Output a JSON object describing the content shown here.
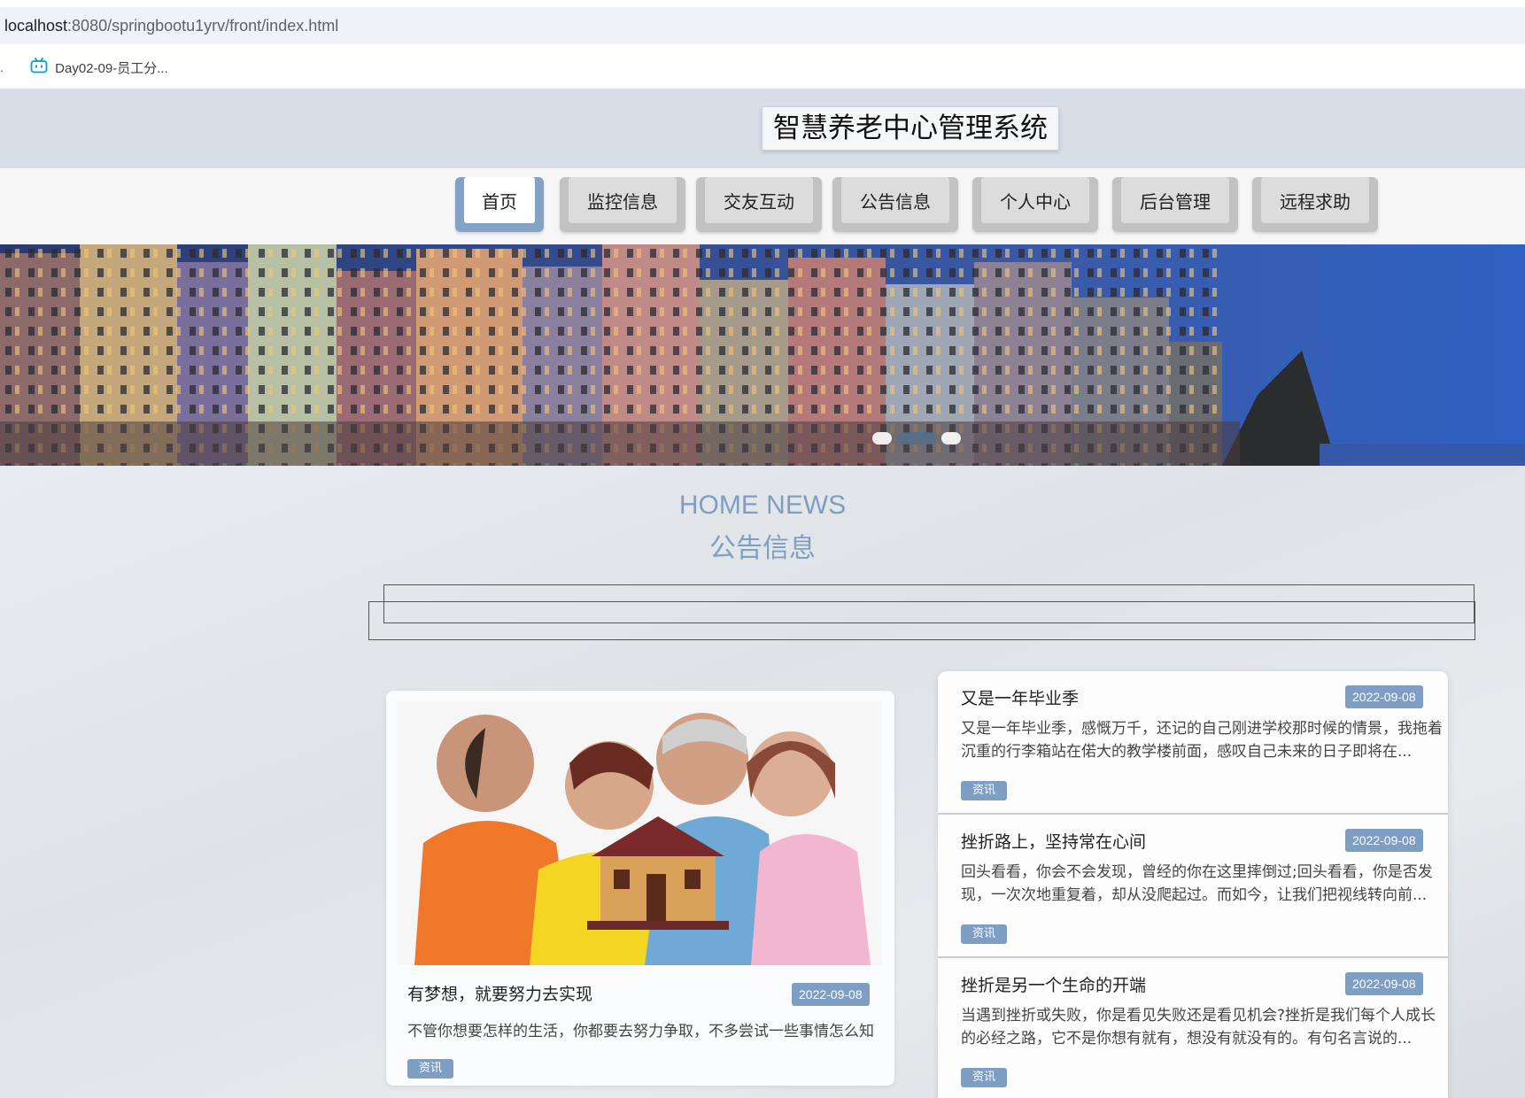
{
  "browser": {
    "url_host": "localhost",
    "url_rest": ":8080/springbootu1yrv/front/index.html",
    "bookmark_dot": ".",
    "bookmark_label": "Day02-09-员工分..."
  },
  "header": {
    "title": "智慧养老中心管理系统"
  },
  "nav": {
    "items": [
      {
        "label": "首页",
        "active": true
      },
      {
        "label": "监控信息"
      },
      {
        "label": "交友互动"
      },
      {
        "label": "公告信息"
      },
      {
        "label": "个人中心"
      },
      {
        "label": "后台管理"
      },
      {
        "label": "远程求助"
      }
    ]
  },
  "banner": {
    "slide_count": 3,
    "active_slide": 2
  },
  "section": {
    "title_en": "HOME NEWS",
    "title_zh": "公告信息"
  },
  "feature": {
    "title": "有梦想，就要努力去实现",
    "date": "2022-09-08",
    "desc": "不管你想要怎样的生活，你都要去努力争取，不多尝试一些事情怎么知",
    "tag": "资讯"
  },
  "news": [
    {
      "title": "又是一年毕业季",
      "date": "2022-09-08",
      "desc": "又是一年毕业季，感慨万千，还记的自己刚进学校那时候的情景，我拖着沉重的行李箱站在偌大的教学楼前面，感叹自己未来的日子即将在...",
      "tag": "资讯"
    },
    {
      "title": "挫折路上，坚持常在心间",
      "date": "2022-09-08",
      "desc": "回头看看，你会不会发现，曾经的你在这里摔倒过;回头看看，你是否发现，一次次地重复着，却从没爬起过。而如今，让我们把视线转向前...",
      "tag": "资讯"
    },
    {
      "title": "挫折是另一个生命的开端",
      "date": "2022-09-08",
      "desc": "当遇到挫折或失败，你是看见失败还是看见机会?挫折是我们每个人成长的必经之路，它不是你想有就有，想没有就没有的。有句名言说的...",
      "tag": "资讯"
    }
  ]
}
